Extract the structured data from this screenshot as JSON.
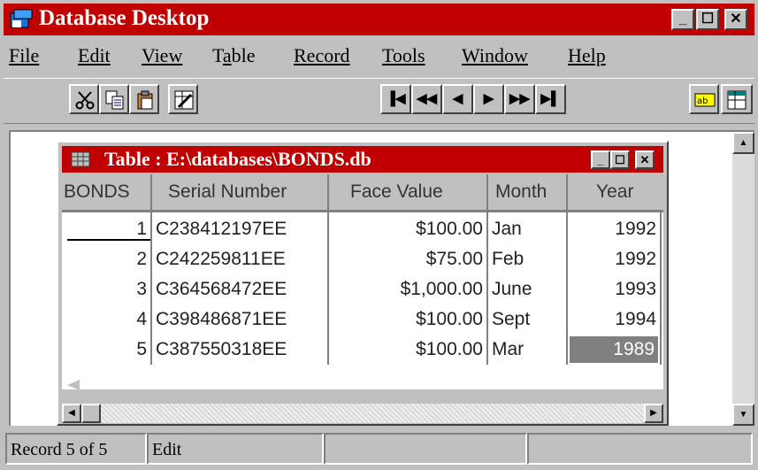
{
  "app": {
    "title": "Database Desktop",
    "icon": "database-desktop-icon",
    "window_controls": [
      "minimize",
      "maximize",
      "close"
    ]
  },
  "menu": [
    {
      "label": "File",
      "underline_first": true
    },
    {
      "label": "Edit",
      "underline_first": true
    },
    {
      "label": "View",
      "underline_first": true
    },
    {
      "label": "Table",
      "underline_index": 1
    },
    {
      "label": "Record",
      "underline_first": true
    },
    {
      "label": "Tools",
      "underline_first": true
    },
    {
      "label": "Window",
      "underline_first": true
    },
    {
      "label": "Help",
      "underline_first": true
    }
  ],
  "toolbar": {
    "tools": [
      "cut-icon",
      "copy-icon",
      "paste-icon",
      "restructure-icon"
    ],
    "navigation": {
      "first": "▐◀",
      "prev_set": "◀◀",
      "prev": "◀",
      "next": "▶",
      "next_set": "▶▶",
      "last": "▶▌"
    },
    "right_tools": [
      "field-view-icon",
      "edit-data-icon"
    ]
  },
  "table_window": {
    "title": "Table : E:\\databases\\BONDS.db",
    "icon": "table-grid-icon",
    "columns": [
      "BONDS",
      "Serial Number",
      "Face Value",
      "Month",
      "Year"
    ],
    "rows": [
      {
        "num": "1",
        "serial": "C238412197EE",
        "face": "$100.00",
        "month": "Jan",
        "year": "1992"
      },
      {
        "num": "2",
        "serial": "C242259811EE",
        "face": "$75.00",
        "month": "Feb",
        "year": "1992"
      },
      {
        "num": "3",
        "serial": "C364568472EE",
        "face": "$1,000.00",
        "month": "June",
        "year": "1993"
      },
      {
        "num": "4",
        "serial": "C398486871EE",
        "face": "$100.00",
        "month": "Sept",
        "year": "1994"
      },
      {
        "num": "5",
        "serial": "C387550318EE",
        "face": "$100.00",
        "month": "Mar",
        "year": "1989"
      }
    ],
    "selected_cell": {
      "row": 5,
      "column": "Year"
    },
    "selection_color": "#808080"
  },
  "status": {
    "record": "Record 5 of 5",
    "mode": "Edit"
  },
  "colors": {
    "titlebar": "#c00000",
    "face": "#c0c0c0"
  }
}
